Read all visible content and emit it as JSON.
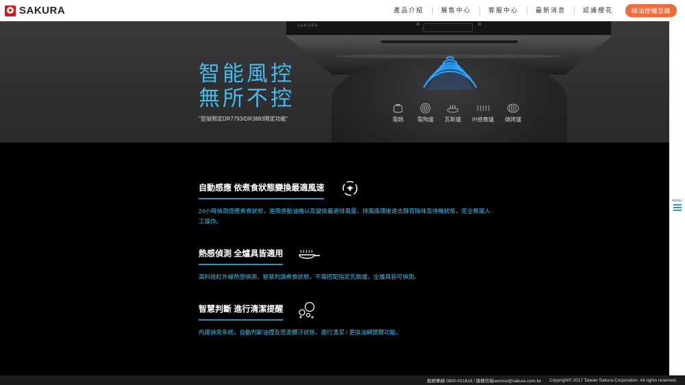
{
  "header": {
    "brand": "SAKURA",
    "nav": [
      "產品介紹",
      "展售中心",
      "客服中心",
      "最新消息",
      "認識櫻花"
    ],
    "cta": "除油煙機型錄"
  },
  "hood": {
    "brand": "SAKURA"
  },
  "hero": {
    "title": "智能風控\n無所不控",
    "note": "\"型號限定DR7793/DR3883限定功能\"",
    "cookers": [
      {
        "label": "電鍋",
        "icon": "rice-cooker-icon"
      },
      {
        "label": "電陶爐",
        "icon": "ceramic-hob-icon"
      },
      {
        "label": "瓦斯爐",
        "icon": "gas-stove-icon"
      },
      {
        "label": "IH感應爐",
        "icon": "induction-hob-icon"
      },
      {
        "label": "燒烤爐",
        "icon": "grill-icon"
      }
    ]
  },
  "features": [
    {
      "title": "自動感應 依煮食狀態變換最適風速",
      "body": "24小時偵測感應煮食狀態，進而啓動油機以及變換最適排風量，排風循環後進去靜音除味及待機狀態，完全無需人工操作。",
      "icon": "fan-cycle-icon"
    },
    {
      "title": "熱感偵測 全爐具皆適用",
      "body": "高科技紅外線熱感偵測，智慧判讀煮食狀態，不需搭配指定瓦斯爐，全爐具皆可偵測。",
      "icon": "pan-heat-icon"
    },
    {
      "title": "智慧判斷 進行清潔提醒",
      "body": "內建偵測系統，自動判斷油煙及感測髒汙狀態，進行清潔 / 更換油網提醒功能。",
      "icon": "bubbles-icon"
    }
  ],
  "sidebar": {
    "menu_label": "MENU"
  },
  "footer": {
    "contact": "服務專線 0800-021818 / 服務信箱service@sakura.com.tw",
    "copyright": "Copyright© 2017 Taiwan Sakura Corporation. All rights reserved."
  },
  "colors": {
    "accent_blue": "#49b9e8",
    "underline_blue": "#2b8fd0",
    "cta_orange": "#f26b3a",
    "brand_red": "#d7141a"
  }
}
